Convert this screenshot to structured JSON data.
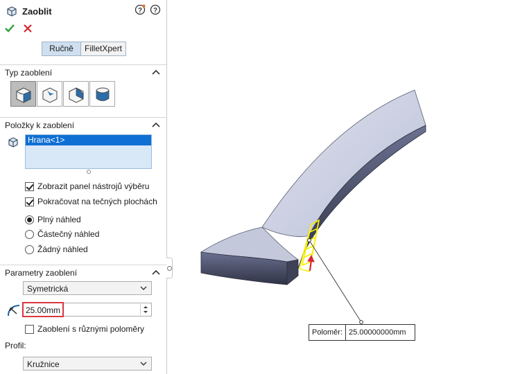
{
  "panel": {
    "title": "Zaoblit",
    "mode_tabs": {
      "manual": "Ručně",
      "expert": "FilletXpert"
    },
    "fillet_type": {
      "header": "Typ zaoblení"
    },
    "items": {
      "header": "Položky k zaoblení",
      "list": [
        "Hrana<1>"
      ],
      "show_selection_toolbar": "Zobrazit panel nástrojů výběru",
      "tangent_propagation": "Pokračovat na tečných plochách",
      "preview_full": "Plný náhled",
      "preview_partial": "Částečný náhled",
      "preview_none": "Žádný náhled"
    },
    "parameters": {
      "header": "Parametry zaoblení",
      "method": "Symetrická",
      "radius": "25.00mm",
      "multi_radius": "Zaoblení s různými poloměry",
      "profile_label": "Profil:",
      "profile": "Kružnice"
    }
  },
  "viewport": {
    "callout_label": "Poloměr:",
    "callout_value": "25.00000000mm"
  },
  "colors": {
    "accent_red": "#d9363e",
    "selection_blue": "#0f6fd3",
    "preview_yellow": "#f5f000"
  }
}
